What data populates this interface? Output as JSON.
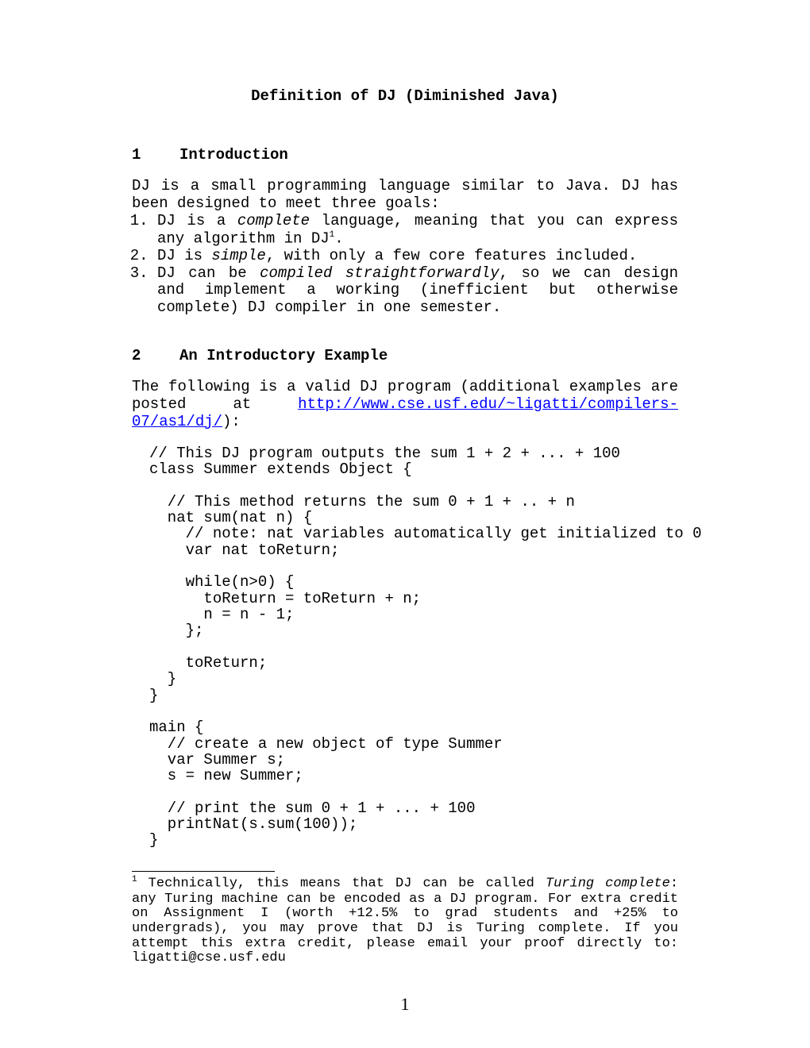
{
  "title": "Definition of DJ (Diminished Java)",
  "section1": {
    "num": "1",
    "heading": "Introduction"
  },
  "intro": "DJ is a small programming language similar to Java.  DJ has been designed to meet three goals:",
  "goals": {
    "g1a": "DJ is a ",
    "g1b": "complete",
    "g1c": " language, meaning that you can express any algorithm in DJ",
    "g1d": ".",
    "fnref1": "1",
    "g2a": "DJ is ",
    "g2b": "simple",
    "g2c": ", with only a few core features included.",
    "g3a": "DJ can be ",
    "g3b": "compiled straightforwardly",
    "g3c": ", so we can design and implement a working (inefficient but otherwise complete) DJ compiler in one semester."
  },
  "section2": {
    "num": "2",
    "heading": "An Introductory Example"
  },
  "examplePara": {
    "pre": "The following is a valid DJ program (additional examples are posted at ",
    "url": "http://www.cse.usf.edu/~ligatti/compilers-07/as1/dj/",
    "post": "):"
  },
  "code": "// This DJ program outputs the sum 1 + 2 + ... + 100\nclass Summer extends Object {\n\n  // This method returns the sum 0 + 1 + .. + n\n  nat sum(nat n) {\n    // note: nat variables automatically get initialized to 0\n    var nat toReturn;\n\n    while(n>0) {\n      toReturn = toReturn + n;\n      n = n - 1;\n    };\n\n    toReturn;\n  }\n}\n\nmain {\n  // create a new object of type Summer\n  var Summer s;\n  s = new Summer;\n\n  // print the sum 0 + 1 + ... + 100\n  printNat(s.sum(100));\n}",
  "footnote": {
    "marker": "1",
    "t1": " Technically, this means that DJ can be called ",
    "t2": "Turing complete",
    "t3": ": any Turing machine can be encoded as a DJ program.  For extra credit on Assignment I (worth +12.5% to grad students and +25% to undergrads), you may prove that DJ is Turing complete.  If you attempt this extra credit, please email your proof directly to: ligatti@cse.usf.edu"
  },
  "pageNumber": "1"
}
